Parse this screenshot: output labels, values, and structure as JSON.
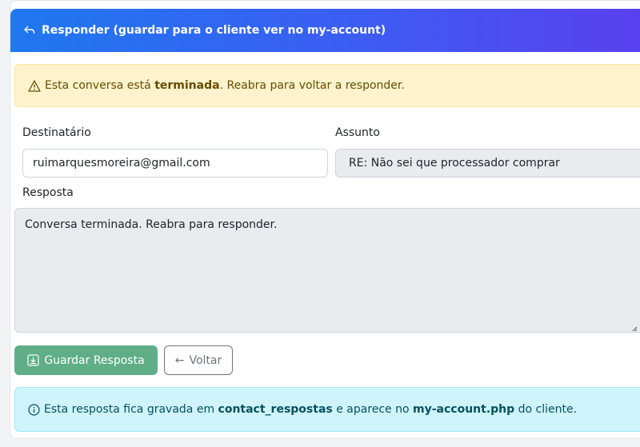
{
  "header": {
    "title": "Responder (guardar para o cliente ver no my-account)",
    "icon": "reply-icon"
  },
  "warning": {
    "icon": "warning-triangle-icon",
    "prefix": "Esta conversa está",
    "strong": "terminada",
    "suffix": ". Reabra para voltar a responder."
  },
  "form": {
    "recipient_label": "Destinatário",
    "recipient_value": "ruimarquesmoreira@gmail.com",
    "subject_label": "Assunto",
    "subject_value": "RE: Não sei que processador comprar",
    "reply_label": "Resposta",
    "reply_value": "Conversa terminada. Reabra para responder."
  },
  "buttons": {
    "save_label": "Guardar Resposta",
    "save_icon": "save-download-icon",
    "back_label": "Voltar",
    "back_arrow": "←"
  },
  "info": {
    "icon": "info-circle-icon",
    "part1": "Esta resposta fica gravada em",
    "strong1": "contact_respostas",
    "part2": "e aparece no",
    "strong2": "my-account.php",
    "part3": "do cliente."
  },
  "colors": {
    "header_gradient_start": "#1f78f0",
    "header_gradient_end": "#5a3ff0",
    "warning_bg": "#fff3cd",
    "info_bg": "#cff4fc",
    "save_button": "#5fae88"
  }
}
